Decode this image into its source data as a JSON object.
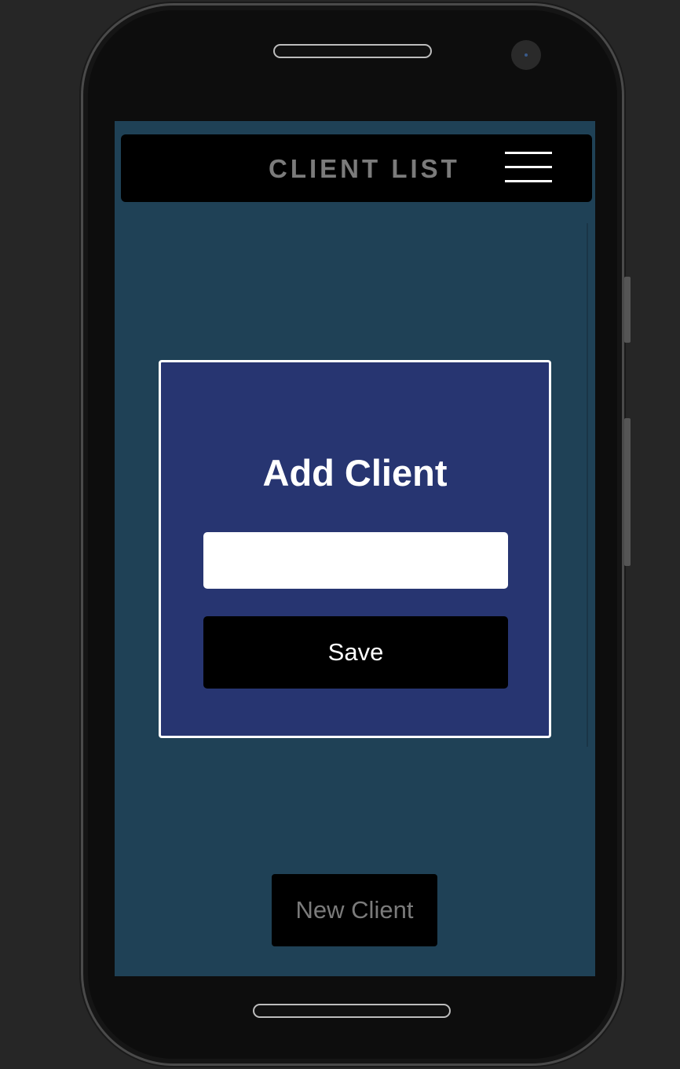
{
  "navbar": {
    "title": "CLIENT LIST",
    "menu_icon": "hamburger-menu-icon"
  },
  "modal": {
    "title": "Add Client",
    "input_value": "",
    "input_placeholder": "",
    "save_label": "Save"
  },
  "footer": {
    "new_client_label": "New Client"
  },
  "colors": {
    "screen_background": "#1f4156",
    "navbar_background": "#000000",
    "navbar_text": "#7b7b7b",
    "modal_background": "#273571",
    "modal_border": "#ffffff",
    "button_background": "#000000"
  }
}
